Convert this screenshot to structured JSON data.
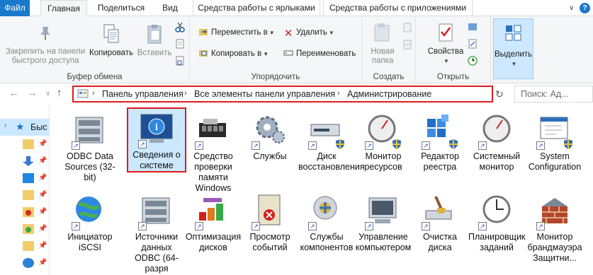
{
  "tabs": {
    "file": "Файл",
    "home": "Главная",
    "share": "Поделиться",
    "view": "Вид",
    "shortcut_tools": "Средства работы с ярлыками",
    "app_tools": "Средства работы с приложениями"
  },
  "ribbon": {
    "clipboard": {
      "pin": "Закрепить на панели быстрого доступа",
      "copy": "Копировать",
      "paste": "Вставить",
      "label": "Буфер обмена"
    },
    "organize": {
      "move": "Переместить в",
      "copy_to": "Копировать в",
      "delete": "Удалить",
      "rename": "Переименовать",
      "label": "Упорядочить"
    },
    "new": {
      "new_folder": "Новая папка",
      "label": "Создать"
    },
    "open": {
      "properties": "Свойства",
      "label": "Открыть"
    },
    "select": {
      "select": "Выделить"
    }
  },
  "address": {
    "crumbs": [
      "Панель управления",
      "Все элементы панели управления",
      "Администрирование"
    ],
    "search_placeholder": "Поиск: Ад..."
  },
  "nav_pane": {
    "quick_access": "Быс"
  },
  "items": [
    {
      "label": "ODBC Data Sources (32-bit)",
      "icon": "odbc-icon"
    },
    {
      "label": "Сведения о системе",
      "icon": "system-info-icon"
    },
    {
      "label": "Средство проверки памяти Windows",
      "icon": "memory-check-icon"
    },
    {
      "label": "Службы",
      "icon": "services-gear-icon"
    },
    {
      "label": "Диск восстановления",
      "icon": "recovery-drive-icon"
    },
    {
      "label": "Монитор ресурсов",
      "icon": "resource-monitor-icon"
    },
    {
      "label": "Редактор реестра",
      "icon": "registry-editor-icon"
    },
    {
      "label": "Системный монитор",
      "icon": "performance-monitor-icon"
    },
    {
      "label": "System Configuration",
      "icon": "system-configuration-icon"
    },
    {
      "label": "Инициатор iSCSI",
      "icon": "iscsi-icon"
    },
    {
      "label": "Источники данных ODBC (64-разря",
      "icon": "odbc64-icon"
    },
    {
      "label": "Оптимизация дисков",
      "icon": "defrag-icon"
    },
    {
      "label": "Просмотр событий",
      "icon": "event-viewer-icon"
    },
    {
      "label": "Службы компонентов",
      "icon": "component-services-icon"
    },
    {
      "label": "Управление компьютером",
      "icon": "computer-management-icon"
    },
    {
      "label": "Очистка диска",
      "icon": "disk-cleanup-icon"
    },
    {
      "label": "Планировщик заданий",
      "icon": "task-scheduler-icon"
    },
    {
      "label": "Монитор брандмауэра Защитни...",
      "icon": "firewall-icon"
    }
  ],
  "colors": {
    "accent": "#1979ca",
    "highlight": "#e01b1b",
    "selection": "#cce8ff"
  }
}
